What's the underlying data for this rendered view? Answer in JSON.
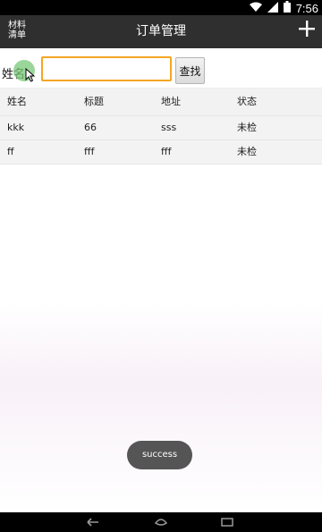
{
  "status_bar": {
    "time": "7:56"
  },
  "app_bar": {
    "left_label_line1": "材料",
    "left_label_line2": "清单",
    "title": "订单管理",
    "add_icon": "plus-icon"
  },
  "search": {
    "label": "姓名",
    "input_value": "",
    "button_label": "查找"
  },
  "table": {
    "headers": [
      "姓名",
      "标题",
      "地址",
      "状态"
    ],
    "rows": [
      [
        "kkk",
        "66",
        "sss",
        "未检"
      ],
      [
        "ff",
        "fff",
        "fff",
        "未检"
      ]
    ]
  },
  "toast": {
    "text": "success"
  },
  "colors": {
    "app_bar": "#2f2f2f",
    "input_border": "#f5a623",
    "toast": "#555555"
  },
  "nav_icons": [
    "back-icon",
    "home-icon",
    "recent-apps-icon"
  ]
}
